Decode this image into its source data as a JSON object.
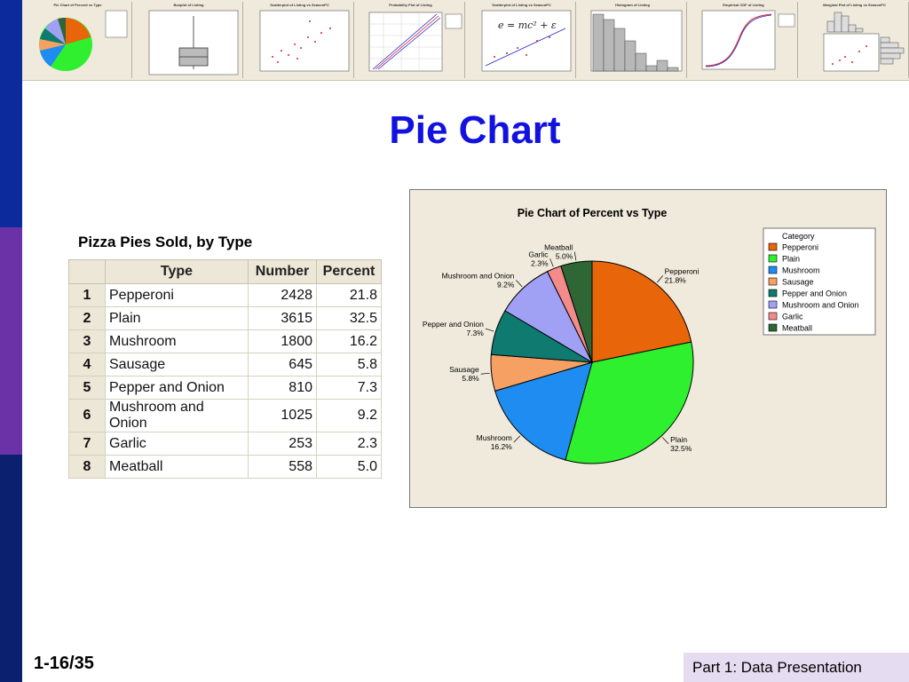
{
  "slide": {
    "title": "Pie Chart",
    "table_caption": "Pizza Pies Sold, by Type",
    "footer_page": "1-16/35",
    "footer_section": "Part 1: Data Presentation"
  },
  "thumbnails": [
    {
      "title": "Pie Chart of Percent vs Type"
    },
    {
      "title": "Boxplot of Listing"
    },
    {
      "title": "Scatterplot of Listing vs SeasonPC"
    },
    {
      "title": "Probability Plot of Listing"
    },
    {
      "title": "Scatterplot of Listing vs SeasonPC"
    },
    {
      "title": "Histogram of Listing"
    },
    {
      "title": "Empirical CDF of Listing"
    },
    {
      "title": "Marginal Plot of Listing vs SeasonPC"
    }
  ],
  "thumb_equation": "e = mc² + ε",
  "table": {
    "headers": {
      "type": "Type",
      "number": "Number",
      "percent": "Percent"
    },
    "rows": [
      {
        "idx": "1",
        "type": "Pepperoni",
        "number": "2428",
        "percent": "21.8"
      },
      {
        "idx": "2",
        "type": "Plain",
        "number": "3615",
        "percent": "32.5"
      },
      {
        "idx": "3",
        "type": "Mushroom",
        "number": "1800",
        "percent": "16.2"
      },
      {
        "idx": "4",
        "type": "Sausage",
        "number": "645",
        "percent": "5.8"
      },
      {
        "idx": "5",
        "type": "Pepper and Onion",
        "number": "810",
        "percent": "7.3"
      },
      {
        "idx": "6",
        "type": "Mushroom and Onion",
        "number": "1025",
        "percent": "9.2"
      },
      {
        "idx": "7",
        "type": "Garlic",
        "number": "253",
        "percent": "2.3"
      },
      {
        "idx": "8",
        "type": "Meatball",
        "number": "558",
        "percent": "5.0"
      }
    ]
  },
  "chart_data": {
    "type": "pie",
    "title": "Pie Chart of Percent vs Type",
    "legend_title": "Category",
    "legend_position": "top-right",
    "categories": [
      "Pepperoni",
      "Plain",
      "Mushroom",
      "Sausage",
      "Pepper and Onion",
      "Mushroom and Onion",
      "Garlic",
      "Meatball"
    ],
    "values": [
      21.8,
      32.5,
      16.2,
      5.8,
      7.3,
      9.2,
      2.3,
      5.0
    ],
    "value_labels": [
      "21.8%",
      "32.5%",
      "16.2%",
      "5.8%",
      "7.3%",
      "9.2%",
      "2.3%",
      "5.0%"
    ],
    "colors": [
      "#e8650a",
      "#2ef02e",
      "#1e8cf0",
      "#f7a064",
      "#0e7a70",
      "#a0a0f5",
      "#f58a8a",
      "#2e6636"
    ]
  }
}
